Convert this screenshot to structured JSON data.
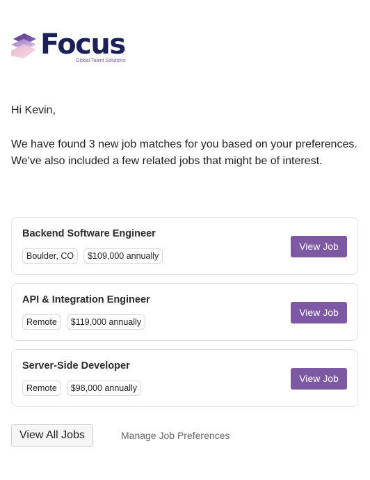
{
  "brand": {
    "name": "Focus",
    "tagline": "Global Talent Solutions",
    "colors": {
      "wordmark": "#1b2057",
      "accent_purple": "#7d58a3",
      "tagline": "#7a5aa6"
    },
    "icon": "layered-cube-logo-icon"
  },
  "greeting": "Hi Kevin,",
  "intro": "We have found 3 new job matches for you based on your preferences. We've also included a few related jobs that might be of interest.",
  "jobs": [
    {
      "title": "Backend Software Engineer",
      "location": "Boulder, CO",
      "salary": "$109,000 annually",
      "button": "View Job"
    },
    {
      "title": "API & Integration Engineer",
      "location": "Remote",
      "salary": "$119,000 annually",
      "button": "View Job"
    },
    {
      "title": "Server-Side Developer",
      "location": "Remote",
      "salary": "$98,000 annually",
      "button": "View Job"
    }
  ],
  "actions": {
    "view_all": "View All Jobs",
    "manage_prefs": "Manage Job Preferences"
  }
}
